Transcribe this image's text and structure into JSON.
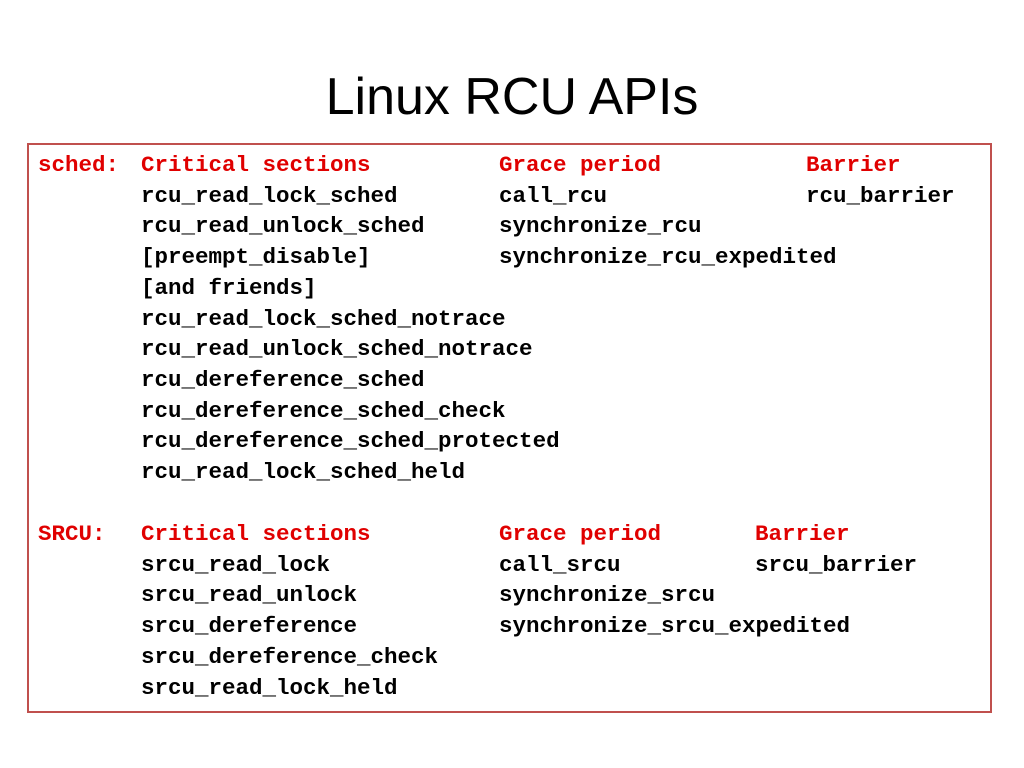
{
  "title": "Linux RCU APIs",
  "accent_color": "#e00000",
  "border_color": "#c0504d",
  "sched": {
    "label": "sched:",
    "headers": {
      "critical": "Critical sections",
      "grace": "Grace period",
      "barrier": "Barrier"
    },
    "critical": [
      "rcu_read_lock_sched",
      "rcu_read_unlock_sched",
      "[preempt_disable]",
      "[and friends]",
      "rcu_read_lock_sched_notrace",
      "rcu_read_unlock_sched_notrace",
      "rcu_dereference_sched",
      "rcu_dereference_sched_check",
      "rcu_dereference_sched_protected",
      "rcu_read_lock_sched_held"
    ],
    "grace": [
      "call_rcu",
      "synchronize_rcu",
      "synchronize_rcu_expedited"
    ],
    "barrier": [
      "rcu_barrier"
    ]
  },
  "srcu": {
    "label": "SRCU:",
    "headers": {
      "critical": "Critical sections",
      "grace": "Grace period",
      "barrier": "Barrier"
    },
    "critical": [
      "srcu_read_lock",
      "srcu_read_unlock",
      "srcu_dereference",
      "srcu_dereference_check",
      "srcu_read_lock_held"
    ],
    "grace": [
      "call_srcu",
      "synchronize_srcu",
      "synchronize_srcu_expedited"
    ],
    "barrier": [
      "srcu_barrier"
    ]
  }
}
